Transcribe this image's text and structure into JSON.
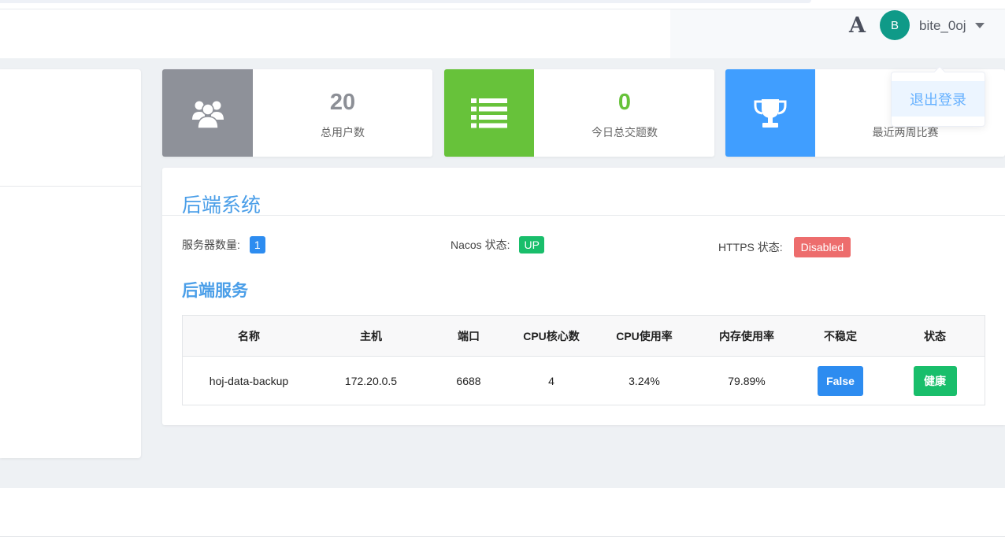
{
  "header": {
    "font_icon": "A",
    "avatar_letter": "B",
    "username": "bite_0oj",
    "dropdown_item": "退出登录"
  },
  "stats": [
    {
      "icon": "users-icon",
      "value": "20",
      "label": "总用户数",
      "color": "#8e9199"
    },
    {
      "icon": "list-icon",
      "value": "0",
      "label": "今日总交题数",
      "color": "#67c23a"
    },
    {
      "icon": "trophy-icon",
      "value": "",
      "label": "最近两周比赛",
      "color": "#409eff"
    }
  ],
  "panel": {
    "title": "后端系统",
    "server_count_label": "服务器数量:",
    "server_count": "1",
    "nacos_label": "Nacos 状态:",
    "nacos_status": "UP",
    "https_label": "HTTPS 状态:",
    "https_status": "Disabled",
    "section_title": "后端服务"
  },
  "table": {
    "columns": [
      "名称",
      "主机",
      "端口",
      "CPU核心数",
      "CPU使用率",
      "内存使用率",
      "不稳定",
      "状态"
    ],
    "rows": [
      {
        "name": "hoj-data-backup",
        "host": "172.20.0.5",
        "port": "6688",
        "cores": "4",
        "cpu": "3.24%",
        "mem": "79.89%",
        "unstable": "False",
        "status": "健康"
      }
    ]
  }
}
